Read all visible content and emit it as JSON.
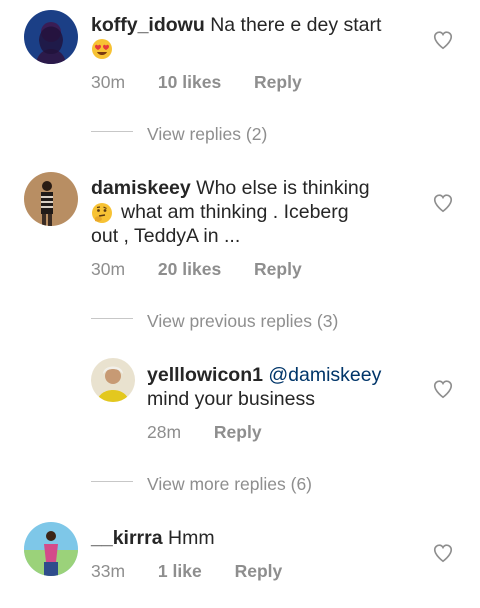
{
  "comments": [
    {
      "username": "koffy_idowu",
      "text": "Na there e dey start",
      "emoji": "heart-eyes",
      "time": "30m",
      "likes": "10 likes",
      "reply": "Reply",
      "replies_link": "View replies (2)"
    },
    {
      "username": "damiskeey",
      "text_line1": "Who else is thinking",
      "text_line2": "what am thinking . Iceberg",
      "text_line3": "out , TeddyA in ...",
      "emoji": "thinking",
      "time": "30m",
      "likes": "20 likes",
      "reply": "Reply",
      "previous_replies_link": "View previous replies (3)",
      "reply_item": {
        "username": "yelllowicon1",
        "mention": "@damiskeey",
        "text": "mind your business",
        "time": "28m",
        "reply": "Reply"
      },
      "more_replies_link": "View more replies (6)"
    },
    {
      "username": "__kirrra",
      "text": "Hmm",
      "time": "33m",
      "likes": "1 like",
      "reply": "Reply"
    }
  ]
}
